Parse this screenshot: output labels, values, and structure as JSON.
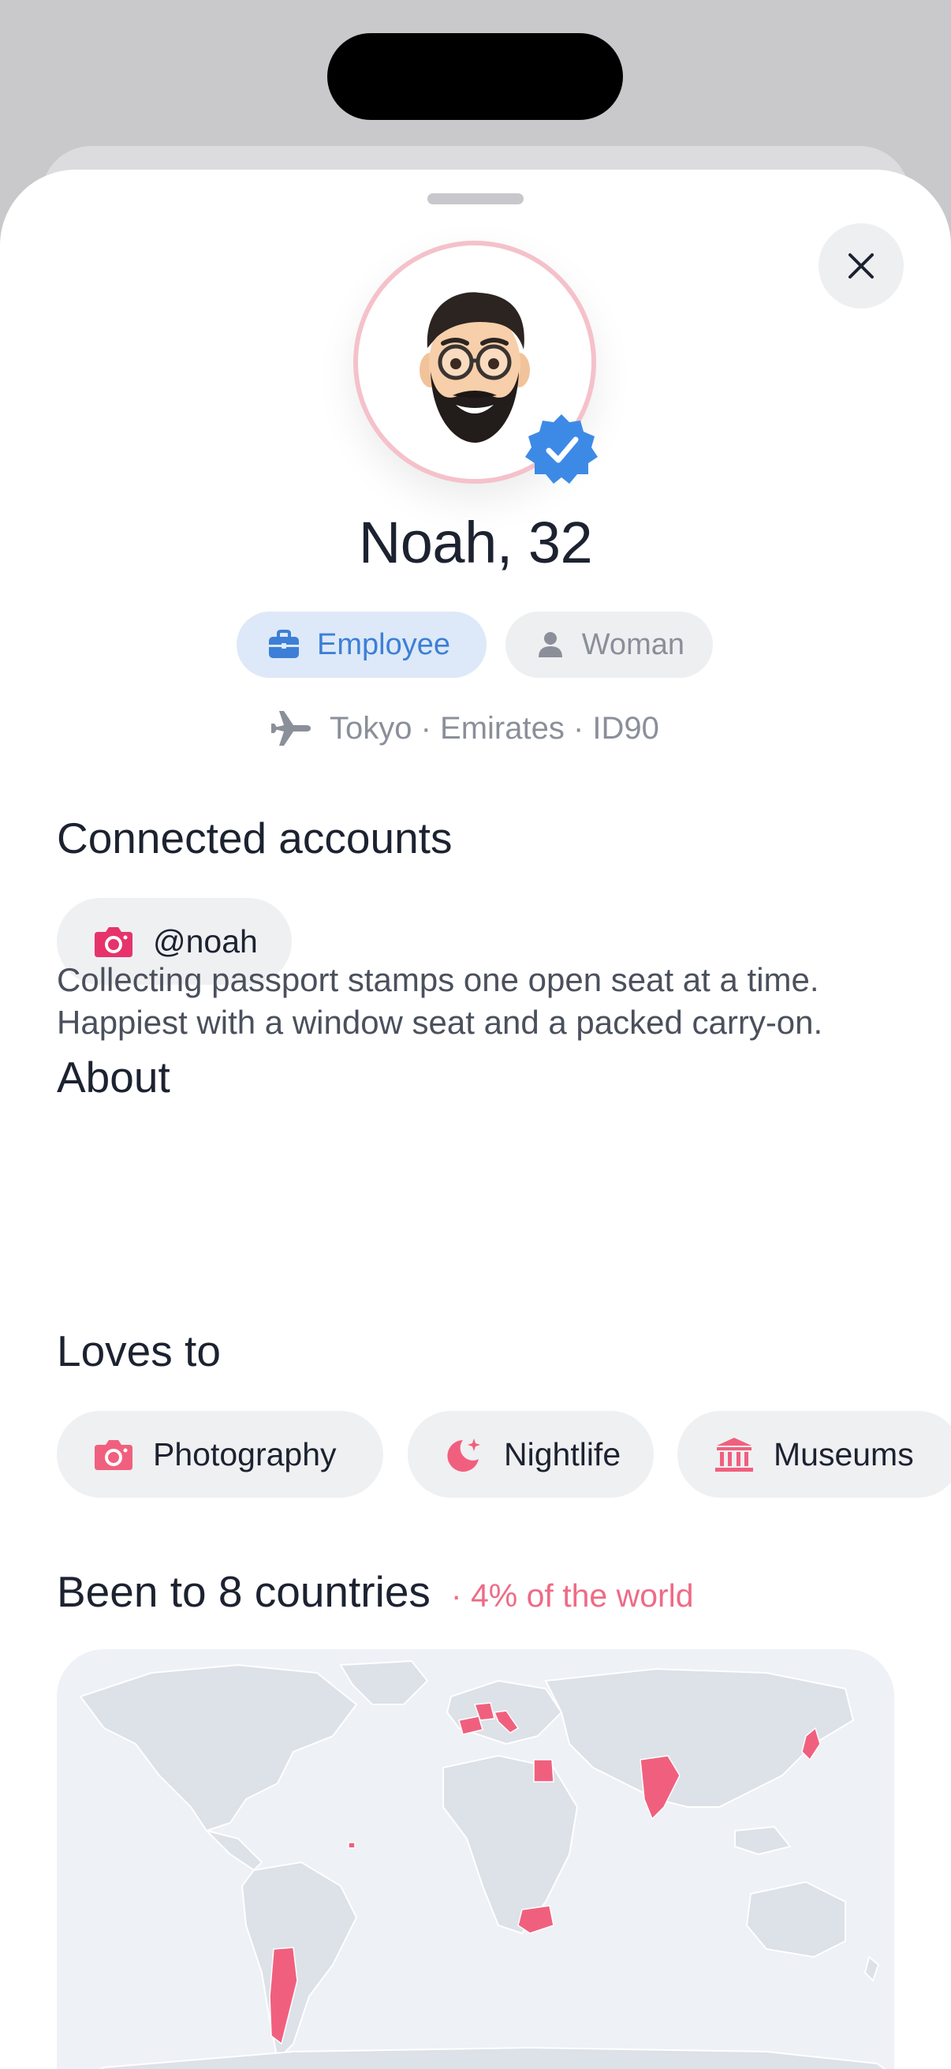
{
  "profile": {
    "name": "Noah, 32",
    "role_chip": "Employee",
    "gender_chip": "Woman",
    "meta": "Tokyo · Emirates · ID90"
  },
  "connected": {
    "title": "Connected accounts",
    "handle": "@noah"
  },
  "about": {
    "title": "About",
    "text": "Collecting passport stamps one open seat at a time. Happiest with a window seat and a packed carry-on."
  },
  "loves": {
    "title": "Loves to",
    "items": [
      {
        "label": "Photography",
        "icon": "camera-icon"
      },
      {
        "label": "Nightlife",
        "icon": "moon-stars-icon"
      },
      {
        "label": "Museums",
        "icon": "museum-icon"
      }
    ]
  },
  "countries": {
    "title": "Been to 8 countries",
    "subtitle": "· 4% of the world",
    "visited": [
      "Spain",
      "France",
      "Italy",
      "Egypt",
      "India",
      "Japan",
      "Argentina",
      "South Africa"
    ]
  },
  "colors": {
    "accent_pink": "#ee6b86",
    "accent_blue": "#3d7fd6",
    "visited_fill": "#f0607e",
    "land_fill": "#dde1e8",
    "ring": "#f5c1cb"
  }
}
